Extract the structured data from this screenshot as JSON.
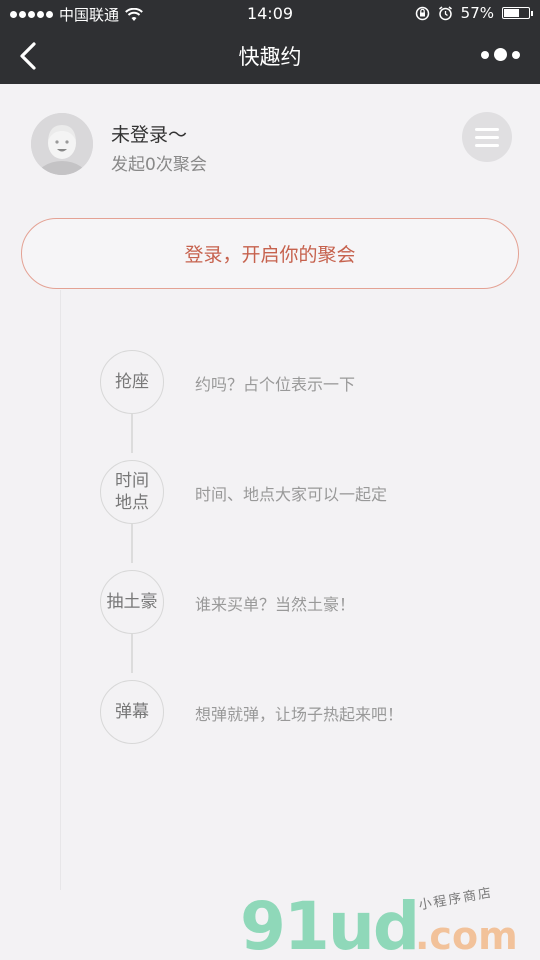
{
  "status_bar": {
    "carrier": "中国联通",
    "time": "14:09",
    "battery": "57%"
  },
  "nav": {
    "title": "快趣约"
  },
  "profile": {
    "name": "未登录～",
    "count_text": "发起0次聚会"
  },
  "login_button": {
    "label": "登录，开启你的聚会"
  },
  "steps": [
    {
      "title": "抢座",
      "desc": "约吗？占个位表示一下"
    },
    {
      "title": "时间\n地点",
      "desc": "时间、地点大家可以一起定"
    },
    {
      "title": "抽土豪",
      "desc": "谁来买单？当然土豪！"
    },
    {
      "title": "弹幕",
      "desc": "想弹就弹，让场子热起来吧！"
    }
  ],
  "watermark": {
    "logo": "91ud",
    "tagline": "小程序商店",
    "domain": ".com"
  }
}
